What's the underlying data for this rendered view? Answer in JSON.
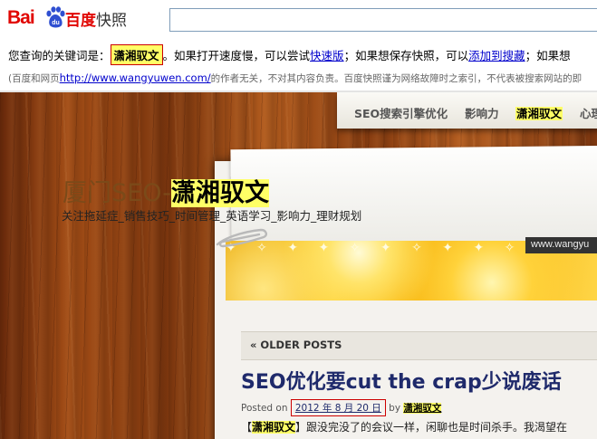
{
  "header": {
    "logo": {
      "latin": "Bai",
      "paw_text": "du",
      "chinese": "百度",
      "product": "快照"
    },
    "search": {
      "value": ""
    }
  },
  "notice": {
    "prefix": "您查询的关键词是：",
    "keyword": "潇湘驭文",
    "middle": "。如果打开速度慢，可以尝试",
    "fast_link": "快速版",
    "middle2": "；如果想保存快照，可以",
    "add_link": "添加到搜藏",
    "tail": "；如果想",
    "disclaimer_prefix": "(百度和网页",
    "url": "http://www.wangyuwen.com/",
    "disclaimer_tail": "的作者无关，不对其内容负责。百度快照谨为网络故障时之索引，不代表被搜索网站的即"
  },
  "site": {
    "nav": [
      {
        "label": "SEO搜索引擎优化"
      },
      {
        "label": "影响力"
      },
      {
        "label": "潇湘驭文"
      },
      {
        "label": "心理"
      }
    ],
    "title_prefix": "厦门SEO-",
    "title_name": "潇湘驭文",
    "tagline": "关注拖延症_销售技巧_时间管理_英语学习_影响力_理财规划",
    "banner_url": "www.wangyu",
    "older_posts": "« OLDER POSTS",
    "post": {
      "title": "SEO优化要cut the crap少说废话",
      "meta_prefix": "Posted on",
      "date": "2012 年 8 月 20 日",
      "by": "by",
      "author": "潇湘驭文",
      "excerpt_open": "【",
      "excerpt_kw": "潇湘驭文",
      "excerpt_rest": "】跟没完没了的会议一样，闲聊也是时间杀手。我渴望在"
    }
  },
  "colors": {
    "baidu_red": "#e10602",
    "highlight": "#ffff66",
    "link": "#0000cc",
    "title_blue": "#1f2a6b"
  }
}
